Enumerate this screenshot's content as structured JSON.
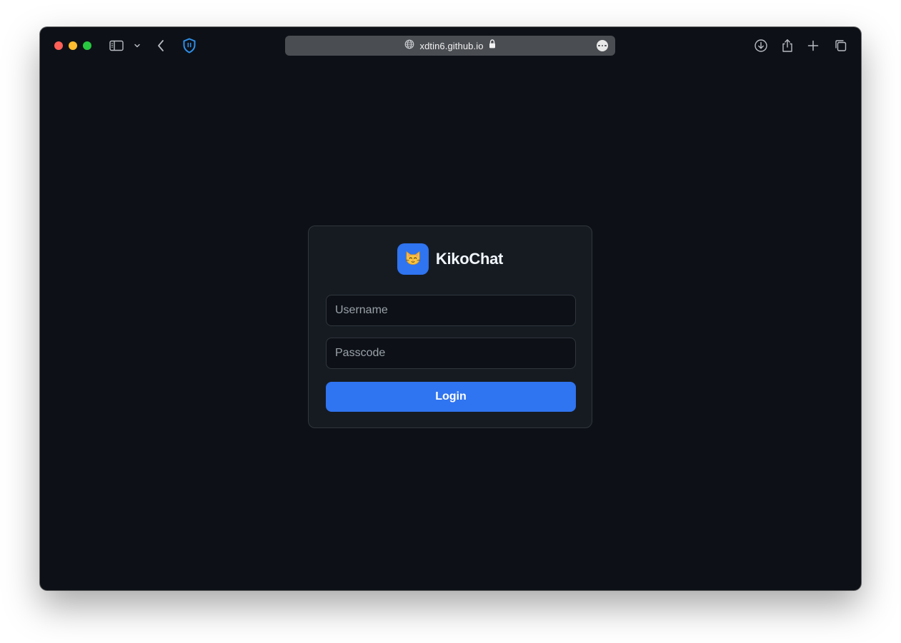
{
  "browser": {
    "url": "xdtin6.github.io",
    "colors": {
      "window_bg": "#0d1117",
      "urlbar_bg": "#4a4d52",
      "close": "#ff5f57",
      "minimize": "#febc2e",
      "maximize": "#28c840",
      "shield": "#2f8fe8"
    },
    "icons": [
      "sidebar-toggle-icon",
      "chevron-down-icon",
      "back-arrow-icon",
      "shield-icon",
      "globe-icon",
      "lock-icon",
      "more-icon",
      "download-icon",
      "share-icon",
      "plus-icon",
      "tabs-overview-icon"
    ]
  },
  "login": {
    "app_name": "KikoChat",
    "logo_icon": "cat-face-icon",
    "username_placeholder": "Username",
    "passcode_placeholder": "Passcode",
    "login_label": "Login",
    "colors": {
      "accent": "#2f74f0",
      "card_bg": "#161b22",
      "input_bg": "#0d1117",
      "border": "#30363d"
    }
  }
}
